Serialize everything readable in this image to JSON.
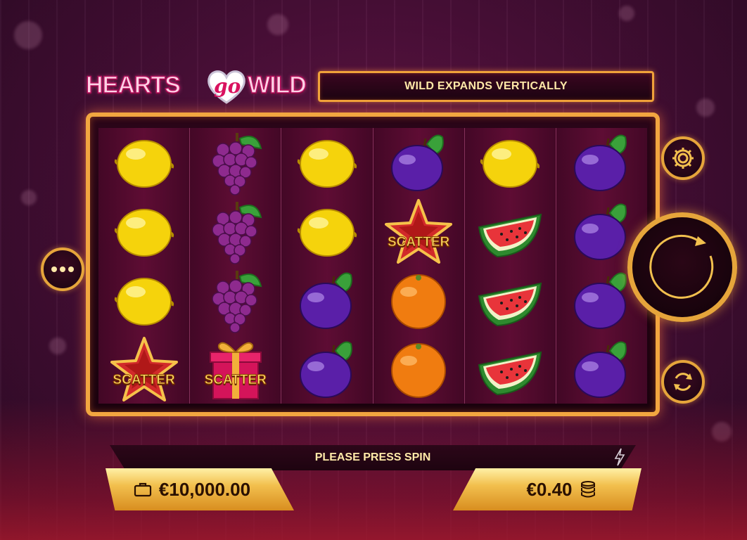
{
  "logo": {
    "part1": "HEARTS",
    "part2": "go",
    "part3": "WILD"
  },
  "banner": {
    "message": "WILD EXPANDS VERTICALLY"
  },
  "reels": [
    [
      "lemon",
      "lemon",
      "lemon",
      "star-scatter"
    ],
    [
      "grapes",
      "grapes",
      "grapes",
      "gift-scatter"
    ],
    [
      "lemon",
      "lemon",
      "plum",
      "plum"
    ],
    [
      "plum",
      "star-scatter",
      "orange",
      "orange"
    ],
    [
      "lemon",
      "watermelon",
      "watermelon",
      "watermelon"
    ],
    [
      "plum",
      "plum",
      "plum",
      "plum"
    ]
  ],
  "scatter_text": "SCATTER",
  "status": {
    "message": "PLEASE PRESS SPIN"
  },
  "balance": {
    "value": "€10,000.00",
    "icon": "wallet-icon"
  },
  "bet": {
    "value": "€0.40",
    "icon": "coins-icon"
  },
  "controls": {
    "settings": "gear-icon",
    "menu": "ellipsis-icon",
    "spin": "spin-arrow-icon",
    "autoplay": "autoplay-icon"
  },
  "colors": {
    "gold": "#f2a640",
    "banner_text": "#ffe9a8",
    "background": "#4a0f38"
  }
}
